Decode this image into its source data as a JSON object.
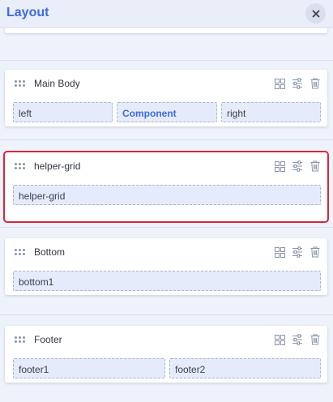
{
  "header": {
    "title": "Layout",
    "close_icon": "close-icon"
  },
  "sections": [
    {
      "name": "Main Body",
      "selected": false,
      "slots": [
        {
          "label": "left",
          "active": false
        },
        {
          "label": "Component",
          "active": true
        },
        {
          "label": "right",
          "active": false
        }
      ]
    },
    {
      "name": "helper-grid",
      "selected": true,
      "slots": [
        {
          "label": "helper-grid",
          "active": false
        }
      ]
    },
    {
      "name": "Bottom",
      "selected": false,
      "slots": [
        {
          "label": "bottom1",
          "active": false
        }
      ]
    },
    {
      "name": "Footer",
      "selected": false,
      "slots": [
        {
          "label": "footer1",
          "active": false
        },
        {
          "label": "footer2",
          "active": false
        }
      ]
    }
  ],
  "icons": {
    "drag": "drag-handle-icon",
    "grid": "grid-layout-icon",
    "settings": "settings-sliders-icon",
    "delete": "trash-icon"
  },
  "colors": {
    "accent": "#3d6ae0",
    "selected_outline": "#d6273a",
    "slot_background": "#e6ebfb"
  }
}
